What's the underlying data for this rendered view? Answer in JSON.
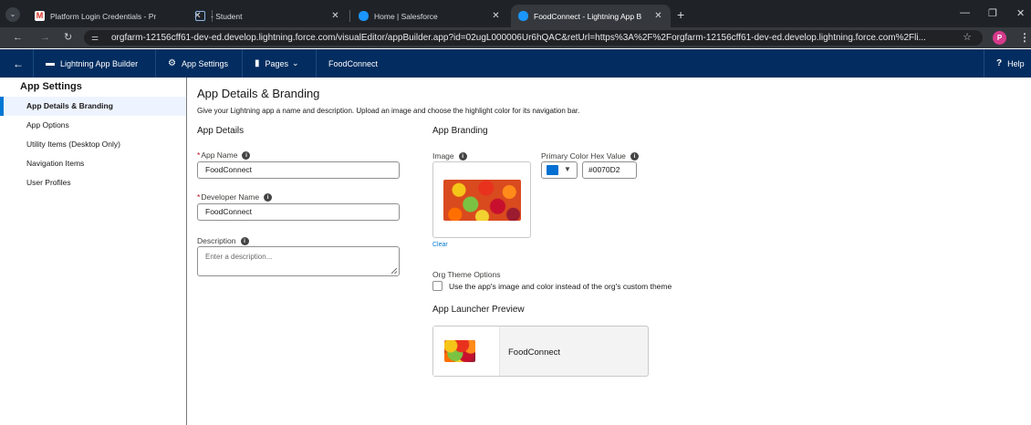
{
  "browser": {
    "tabs": [
      {
        "title": "Platform Login Credentials - Pr",
        "icon": "gmail-icon",
        "active": false
      },
      {
        "title": "- Student",
        "icon": "page-icon",
        "active": false
      },
      {
        "title": "Home | Salesforce",
        "icon": "salesforce-icon",
        "active": false
      },
      {
        "title": "FoodConnect - Lightning App B",
        "icon": "salesforce-icon",
        "active": true
      }
    ],
    "url": "orgfarm-12156cff61-dev-ed.develop.lightning.force.com/visualEditor/appBuilder.app?id=02ugL000006Ur6hQAC&retUrl=https%3A%2F%2Forgfarm-12156cff61-dev-ed.develop.lightning.force.com%2Fli...",
    "profile_initial": "P"
  },
  "header": {
    "back_icon": "arrow-left-icon",
    "builder_label": "Lightning App Builder",
    "settings_label": "App Settings",
    "pages_label": "Pages",
    "app_name": "FoodConnect",
    "help_label": "Help"
  },
  "sidebar": {
    "title": "App Settings",
    "items": [
      {
        "label": "App Details & Branding",
        "active": true
      },
      {
        "label": "App Options",
        "active": false
      },
      {
        "label": "Utility Items (Desktop Only)",
        "active": false
      },
      {
        "label": "Navigation Items",
        "active": false
      },
      {
        "label": "User Profiles",
        "active": false
      }
    ]
  },
  "main": {
    "title": "App Details & Branding",
    "description": "Give your Lightning app a name and description. Upload an image and choose the highlight color for its navigation bar.",
    "details": {
      "heading": "App Details",
      "app_name_label": "App Name",
      "app_name_value": "FoodConnect",
      "developer_name_label": "Developer Name",
      "developer_name_value": "FoodConnect",
      "description_label": "Description",
      "description_placeholder": "Enter a description..."
    },
    "branding": {
      "heading": "App Branding",
      "image_label": "Image",
      "clear_label": "Clear",
      "color_label": "Primary Color Hex Value",
      "color_value": "#0070D2",
      "org_theme_label": "Org Theme Options",
      "org_theme_checkbox_label": "Use the app's image and color instead of the org's custom theme",
      "org_theme_checked": false
    },
    "preview": {
      "heading": "App Launcher Preview",
      "app_name": "FoodConnect"
    }
  },
  "colors": {
    "header_bg": "#032d60",
    "accent": "#0176d3",
    "primary_swatch": "#0070D2"
  }
}
